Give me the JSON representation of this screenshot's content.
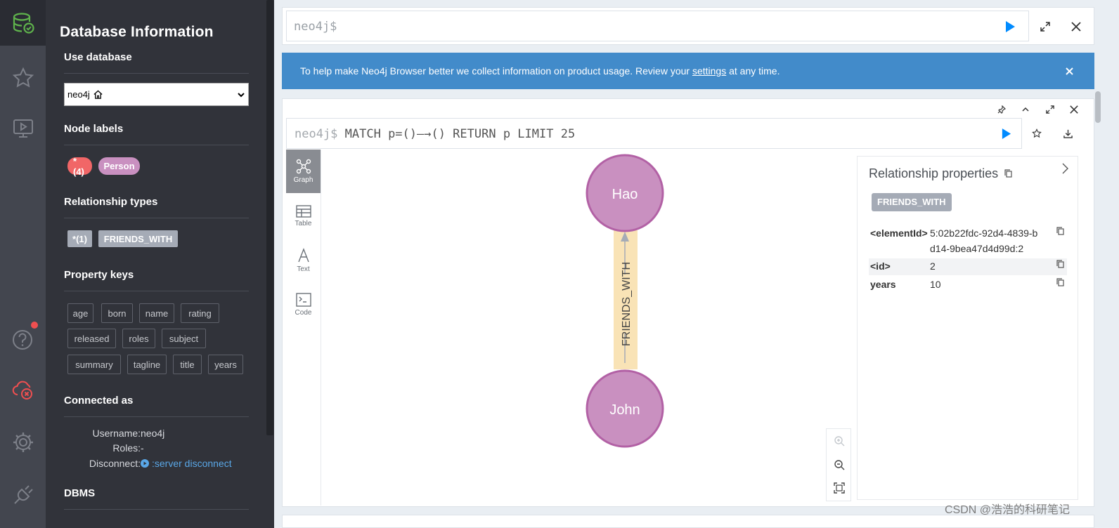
{
  "sidebar": {
    "title": "Database Information",
    "use_database": {
      "title": "Use database",
      "selected": "neo4j",
      "home_icon": "home-icon"
    },
    "node_labels": {
      "title": "Node labels",
      "items": [
        {
          "label": "*(4)",
          "color": "#f16667"
        },
        {
          "label": "Person",
          "color": "#c990c0"
        }
      ]
    },
    "relationship_types": {
      "title": "Relationship types",
      "items": [
        {
          "label": "*(1)",
          "color": "#a5abb6"
        },
        {
          "label": "FRIENDS_WITH",
          "color": "#a5abb6"
        }
      ]
    },
    "property_keys": {
      "title": "Property keys",
      "items": [
        "age",
        "born",
        "name",
        "rating",
        "released",
        "roles",
        "subject",
        "summary",
        "tagline",
        "title",
        "years"
      ]
    },
    "connected_as": {
      "title": "Connected as",
      "username_key": "Username:",
      "username": "neo4j",
      "roles_key": "Roles:",
      "roles": "-",
      "disconnect_key": "Disconnect:",
      "disconnect_link": ":server disconnect"
    },
    "dbms": {
      "title": "DBMS"
    }
  },
  "rail": {
    "icons": [
      "database-icon",
      "star-icon",
      "monitor-play-icon",
      "help-icon",
      "cloud-disconnected-icon",
      "gear-icon",
      "plug-icon"
    ],
    "active": "database-icon"
  },
  "editor": {
    "prompt": "neo4j$"
  },
  "banner": {
    "text_before": "To help make Neo4j Browser better we collect information on product usage. Review your ",
    "link": "settings",
    "text_after": " at any time."
  },
  "result_frame": {
    "prompt": "neo4j$",
    "query": " MATCH p=()—→() RETURN p LIMIT 25",
    "view_tabs": [
      {
        "label": "Graph",
        "icon": "graph-icon",
        "active": true
      },
      {
        "label": "Table",
        "icon": "table-icon",
        "active": false
      },
      {
        "label": "Text",
        "icon": "text-icon",
        "active": false
      },
      {
        "label": "Code",
        "icon": "code-icon",
        "active": false
      }
    ],
    "graph": {
      "nodes": [
        {
          "id": "hao",
          "label": "Hao",
          "color": "#c990c0",
          "border": "#b261a5"
        },
        {
          "id": "john",
          "label": "John",
          "color": "#c990c0",
          "border": "#b261a5"
        }
      ],
      "relationship": {
        "type": "FRIENDS_WITH",
        "from": "john",
        "to": "hao",
        "highlight": "#f9e3b6"
      }
    },
    "properties_panel": {
      "title": "Relationship properties",
      "type_tag": "FRIENDS_WITH",
      "rows": [
        {
          "key": "<elementId>",
          "value": "5:02b22fdc-92d4-4839-bd14-9bea47d4d99d:2"
        },
        {
          "key": "<id>",
          "value": "2"
        },
        {
          "key": "years",
          "value": "10"
        }
      ]
    }
  },
  "watermark": "CSDN @浩浩的科研笔记"
}
